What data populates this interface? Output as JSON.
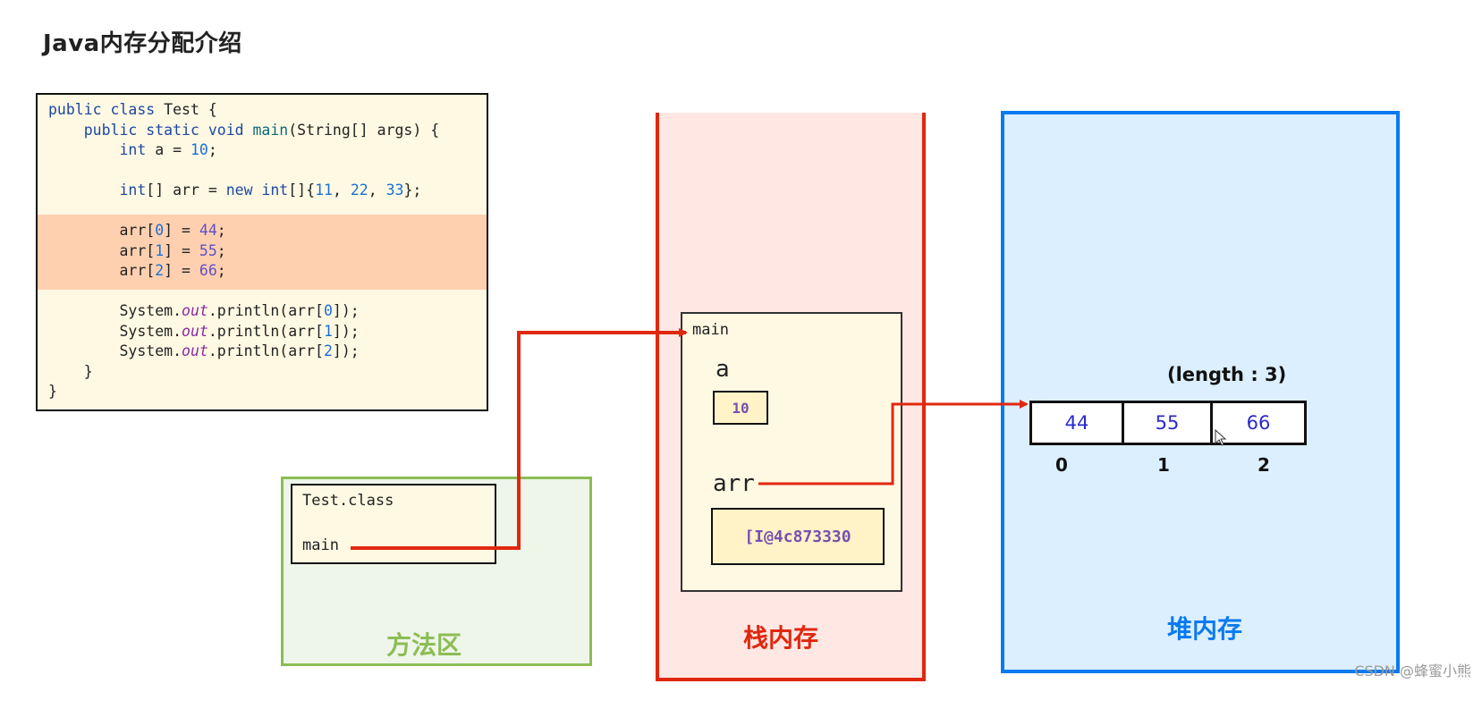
{
  "title": "Java内存分配介绍",
  "code": {
    "lines": [
      {
        "parts": [
          [
            "kw",
            "public class "
          ],
          [
            "",
            "Test {"
          ]
        ]
      },
      {
        "parts": [
          [
            "",
            "    "
          ],
          [
            "kw",
            "public static void "
          ],
          [
            "fn",
            "main"
          ],
          [
            "",
            "(String[] args) {"
          ]
        ]
      },
      {
        "parts": [
          [
            "",
            "        "
          ],
          [
            "kw",
            "int"
          ],
          [
            "",
            " a = "
          ],
          [
            "num",
            "10"
          ],
          [
            "",
            ";"
          ]
        ]
      },
      {
        "parts": [
          [
            "",
            ""
          ]
        ]
      },
      {
        "parts": [
          [
            "",
            "        "
          ],
          [
            "kw",
            "int"
          ],
          [
            "",
            "[] arr = "
          ],
          [
            "kw",
            "new int"
          ],
          [
            "",
            "[]{"
          ],
          [
            "num",
            "11"
          ],
          [
            "",
            ", "
          ],
          [
            "num",
            "22"
          ],
          [
            "",
            ", "
          ],
          [
            "num",
            "33"
          ],
          [
            "",
            "};"
          ]
        ]
      },
      {
        "parts": [
          [
            "",
            ""
          ]
        ]
      },
      {
        "parts": [
          [
            "",
            "        arr["
          ],
          [
            "num",
            "0"
          ],
          [
            "",
            "] = "
          ],
          [
            "num2",
            "44"
          ],
          [
            "",
            ";"
          ]
        ]
      },
      {
        "parts": [
          [
            "",
            "        arr["
          ],
          [
            "num",
            "1"
          ],
          [
            "",
            "] = "
          ],
          [
            "num2",
            "55"
          ],
          [
            "",
            ";"
          ]
        ]
      },
      {
        "parts": [
          [
            "",
            "        arr["
          ],
          [
            "num",
            "2"
          ],
          [
            "",
            "] = "
          ],
          [
            "num2",
            "66"
          ],
          [
            "",
            ";"
          ]
        ]
      },
      {
        "parts": [
          [
            "",
            ""
          ]
        ]
      },
      {
        "parts": [
          [
            "",
            "        System."
          ],
          [
            "ital",
            "out"
          ],
          [
            "",
            ".println(arr["
          ],
          [
            "num",
            "0"
          ],
          [
            "",
            "]);"
          ]
        ]
      },
      {
        "parts": [
          [
            "",
            "        System."
          ],
          [
            "ital",
            "out"
          ],
          [
            "",
            ".println(arr["
          ],
          [
            "num",
            "1"
          ],
          [
            "",
            "]);"
          ]
        ]
      },
      {
        "parts": [
          [
            "",
            "        System."
          ],
          [
            "ital",
            "out"
          ],
          [
            "",
            ".println(arr["
          ],
          [
            "num",
            "2"
          ],
          [
            "",
            "]);"
          ]
        ]
      },
      {
        "parts": [
          [
            "",
            "    }"
          ]
        ]
      },
      {
        "parts": [
          [
            "",
            "}"
          ]
        ]
      }
    ],
    "highlighted_lines": [
      6,
      7,
      8
    ]
  },
  "method_area": {
    "label": "方法区",
    "class_name": "Test.class",
    "method": "main"
  },
  "stack": {
    "label": "栈内存",
    "frame_name": "main",
    "var_a": {
      "name": "a",
      "value": "10"
    },
    "var_arr": {
      "name": "arr",
      "value": "[I@4c873330"
    }
  },
  "heap": {
    "label": "堆内存",
    "length_label": "(length : 3)",
    "cells": [
      "44",
      "55",
      "66"
    ],
    "indices": [
      "0",
      "1",
      "2"
    ]
  },
  "colors": {
    "stack": "#e0280f",
    "heap": "#0a7af0",
    "method_area": "#8cbd55",
    "arrow": "#e0280f"
  },
  "watermark": "CSDN @蜂蜜小熊"
}
